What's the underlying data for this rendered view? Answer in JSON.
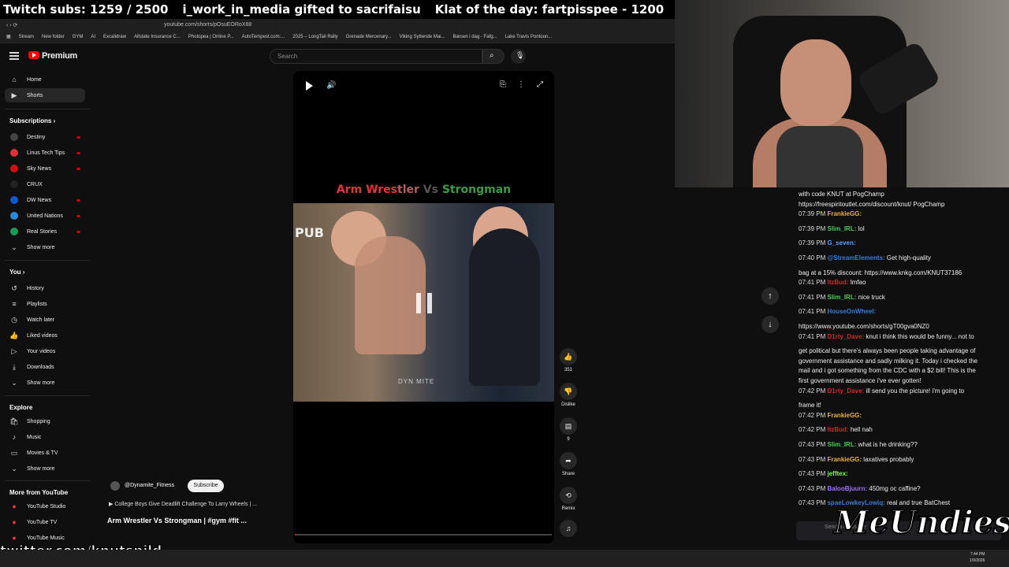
{
  "overlay": {
    "subs": "Twitch subs: 1259 / 2500",
    "gifted": "i_work_in_media gifted to sacrifaisu",
    "klat": "Klat of the day: fartpisspee - 1200",
    "twitter": "twitter.com/knutspild",
    "sponsor": "MeUndies"
  },
  "browser": {
    "url": "youtube.com/shorts/pOsuEORoX88",
    "bookmarks": [
      "Stream",
      "New folder",
      "GYM",
      "AI",
      "Excalidraw",
      "Allstate Insurance C...",
      "Photopea | Online P...",
      "AutoTempest.com:...",
      "2025 – LongTail Rally",
      "Grenade Mercenary...",
      "Viking Syttende Mai...",
      "Bæsen i dag - Fafg...",
      "Lake Travis Pontoon..."
    ]
  },
  "header": {
    "logo_text": "Premium",
    "search_placeholder": "Search"
  },
  "sidebar": {
    "main": [
      {
        "label": "Home",
        "icon": "home-icon"
      },
      {
        "label": "Shorts",
        "icon": "shorts-icon"
      }
    ],
    "subscriptions_title": "Subscriptions",
    "subscriptions": [
      {
        "label": "Destiny",
        "color": "#444"
      },
      {
        "label": "Linus Tech Tips",
        "color": "#d33"
      },
      {
        "label": "Sky News",
        "color": "#c11"
      },
      {
        "label": "CRUX",
        "color": "#222"
      },
      {
        "label": "DW News",
        "color": "#0a5ad0"
      },
      {
        "label": "United Nations",
        "color": "#2a8ad8"
      },
      {
        "label": "Real Stories",
        "color": "#1a9a5a"
      }
    ],
    "show_more": "Show more",
    "you_title": "You",
    "you_items": [
      {
        "label": "History",
        "icon": "history-icon"
      },
      {
        "label": "Playlists",
        "icon": "playlists-icon"
      },
      {
        "label": "Watch later",
        "icon": "watch-later-icon"
      },
      {
        "label": "Liked videos",
        "icon": "liked-icon"
      },
      {
        "label": "Your videos",
        "icon": "your-videos-icon"
      },
      {
        "label": "Downloads",
        "icon": "downloads-icon"
      }
    ],
    "explore_title": "Explore",
    "explore_items": [
      {
        "label": "Shopping",
        "icon": "shopping-icon"
      },
      {
        "label": "Music",
        "icon": "music-icon"
      },
      {
        "label": "Movies & TV",
        "icon": "movies-icon"
      }
    ],
    "more_title": "More from YouTube",
    "more_items": [
      {
        "label": "YouTube Studio"
      },
      {
        "label": "YouTube TV"
      },
      {
        "label": "YouTube Music"
      }
    ]
  },
  "video": {
    "overlay_title_part1": "Arm Wres",
    "overlay_title_part2": "tler",
    "overlay_title_vs": "Vs",
    "overlay_title_part3": "Strongman",
    "pub": "PUB",
    "watermark": "DYN   MITE",
    "channel": "@Dynamite_Fitness",
    "subscribe": "Subscribe",
    "next": "College Boys Give Deadlift Challenge To Larry Wheels | ...",
    "caption": "Arm Wrestler Vs Strongman | #gym #fit ..."
  },
  "actions": [
    {
      "label": "351",
      "icon": "like-icon"
    },
    {
      "label": "Dislike",
      "icon": "dislike-icon"
    },
    {
      "label": "9",
      "icon": "comments-icon"
    },
    {
      "label": "Share",
      "icon": "share-icon"
    },
    {
      "label": "Remix",
      "icon": "remix-icon"
    }
  ],
  "chat": {
    "lines": [
      {
        "ts": "",
        "user": "",
        "color": "#efeff1",
        "msg": "with code KNUT at PogChamp"
      },
      {
        "ts": "",
        "user": "",
        "color": "#efeff1",
        "msg": "https://freespiritoutlet.com/discount/knut/ PogChamp"
      },
      {
        "ts": "07:39 PM",
        "user": "FrankieGG:",
        "color": "#e8b04a",
        "msg": ""
      },
      {
        "ts": "07:39 PM",
        "user": "Slim_IRL:",
        "color": "#4ecb5a",
        "msg": "lol"
      },
      {
        "ts": "07:39 PM",
        "user": "G_seven:",
        "color": "#5aa0ff",
        "msg": ""
      },
      {
        "ts": "07:40 PM",
        "user": "@StreamElements:",
        "color": "#3a7bd5",
        "msg": "Get high-quality"
      },
      {
        "ts": "",
        "user": "",
        "color": "#efeff1",
        "msg": "bag at a 15% discount: https://www.knkg.com/KNUT37186"
      },
      {
        "ts": "07:41 PM",
        "user": "ItzBud:",
        "color": "#d02a2a",
        "msg": "lmfao"
      },
      {
        "ts": "07:41 PM",
        "user": "Slim_IRL:",
        "color": "#4ecb5a",
        "msg": "nice truck"
      },
      {
        "ts": "07:41 PM",
        "user": "HouseOnWheel:",
        "color": "#3a7bd5",
        "msg": ""
      },
      {
        "ts": "",
        "user": "",
        "color": "#efeff1",
        "msg": "https://www.youtube.com/shorts/gT00gva0NZ0"
      },
      {
        "ts": "07:41 PM",
        "user": "D1rty_Dave:",
        "color": "#d02a2a",
        "msg": "knut i think this would be funny... not to"
      },
      {
        "ts": "",
        "user": "",
        "color": "#efeff1",
        "msg": "get political but there's always been people taking advantage of"
      },
      {
        "ts": "",
        "user": "",
        "color": "#efeff1",
        "msg": "government assistance and sadly milking it. Today i checked the"
      },
      {
        "ts": "",
        "user": "",
        "color": "#efeff1",
        "msg": "mail and i got something from the CDC with a $2 bill! This is the"
      },
      {
        "ts": "",
        "user": "",
        "color": "#efeff1",
        "msg": "first government assistance i've ever gotten!"
      },
      {
        "ts": "07:42 PM",
        "user": "D1rty_Dave:",
        "color": "#d02a2a",
        "msg": "ill send you the picture! i'm going to"
      },
      {
        "ts": "",
        "user": "",
        "color": "#efeff1",
        "msg": "frame it!"
      },
      {
        "ts": "07:42 PM",
        "user": "FrankieGG:",
        "color": "#e8b04a",
        "msg": ""
      },
      {
        "ts": "07:42 PM",
        "user": "ItzBud:",
        "color": "#d02a2a",
        "msg": "hell nah"
      },
      {
        "ts": "07:43 PM",
        "user": "Slim_IRL:",
        "color": "#4ecb5a",
        "msg": "what is he drinking??"
      },
      {
        "ts": "07:43 PM",
        "user": "FrankieGG:",
        "color": "#e8b04a",
        "msg": "laxatives probably"
      },
      {
        "ts": "07:43 PM",
        "user": "jefftex:",
        "color": "#7fff4a",
        "msg": ""
      },
      {
        "ts": "07:43 PM",
        "user": "BalooBjuurn:",
        "color": "#a070ff",
        "msg": "450mg oc caffine?"
      },
      {
        "ts": "07:43 PM",
        "user": "spaeLowkeyLowiq:",
        "color": "#3a7bd5",
        "msg": "real and true BatChest"
      }
    ],
    "input_placeholder": "Send a message"
  },
  "tray": {
    "time": "7:44 PM",
    "date": "1/9/2026"
  }
}
